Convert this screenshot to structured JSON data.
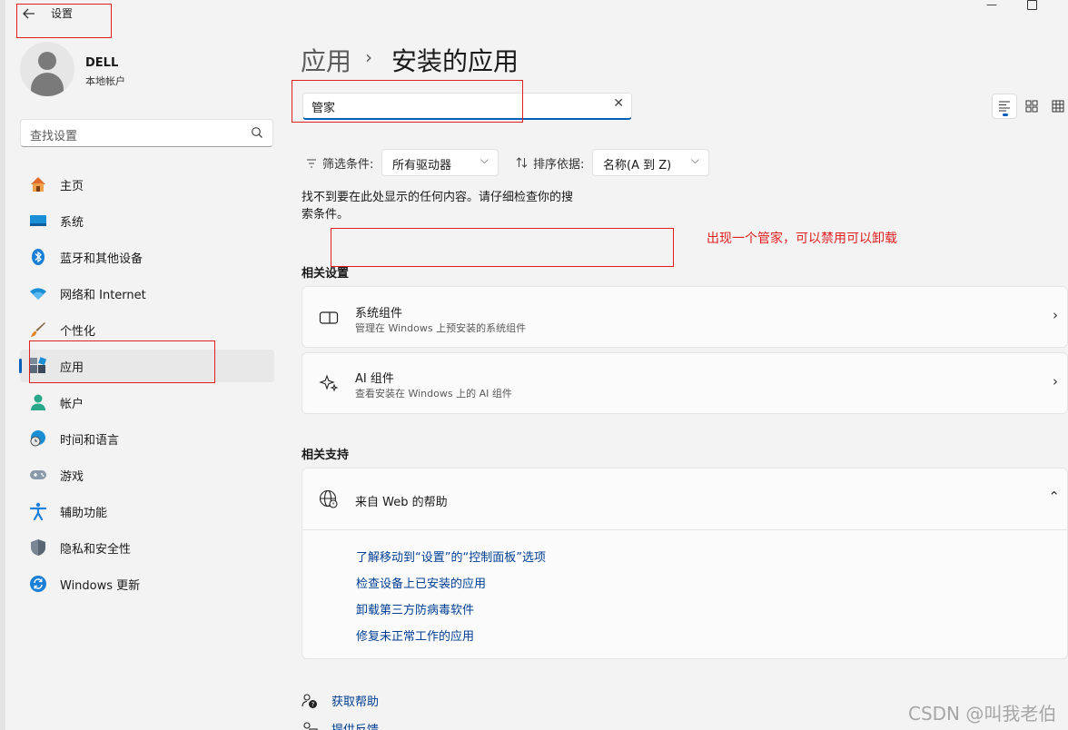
{
  "window": {
    "title": "设置",
    "back_icon": "arrow-left-icon",
    "minimize_glyph": "—"
  },
  "profile": {
    "name": "DELL",
    "account_type": "本地帐户"
  },
  "sidebar": {
    "search_placeholder": "查找设置",
    "items": [
      {
        "label": "主页",
        "icon": "home-icon"
      },
      {
        "label": "系统",
        "icon": "system-icon"
      },
      {
        "label": "蓝牙和其他设备",
        "icon": "bluetooth-icon"
      },
      {
        "label": "网络和 Internet",
        "icon": "wifi-icon"
      },
      {
        "label": "个性化",
        "icon": "brush-icon"
      },
      {
        "label": "应用",
        "icon": "apps-icon",
        "active": true
      },
      {
        "label": "帐户",
        "icon": "account-icon"
      },
      {
        "label": "时间和语言",
        "icon": "globe-clock-icon"
      },
      {
        "label": "游戏",
        "icon": "gamepad-icon"
      },
      {
        "label": "辅助功能",
        "icon": "accessibility-icon"
      },
      {
        "label": "隐私和安全性",
        "icon": "shield-icon"
      },
      {
        "label": "Windows 更新",
        "icon": "update-icon"
      }
    ]
  },
  "header": {
    "breadcrumb_parent": "应用",
    "breadcrumb_separator": "›",
    "breadcrumb_current": "安装的应用"
  },
  "search": {
    "value": "管家",
    "clear_glyph": "✕"
  },
  "filters": {
    "filter_label": "筛选条件:",
    "filter_value": "所有驱动器",
    "sort_label": "排序依据:",
    "sort_value": "名称(A 到 Z)",
    "chevron_glyph": "⌵"
  },
  "results": {
    "empty_message": "找不到要在此处显示的任何内容。请仔细检查你的搜索条件。"
  },
  "annotation": {
    "text": "出现一个管家，可以禁用可以卸载"
  },
  "related_settings": {
    "title": "相关设置",
    "items": [
      {
        "title": "系统组件",
        "subtitle": "管理在 Windows 上预安装的系统组件",
        "icon": "system-components-icon"
      },
      {
        "title": "AI 组件",
        "subtitle": "查看安装在 Windows 上的 AI 组件",
        "icon": "sparkle-icon"
      }
    ],
    "chevron_glyph": "›"
  },
  "related_support": {
    "title": "相关支持",
    "help_title": "来自 Web 的帮助",
    "collapse_glyph": "⌃",
    "links": [
      "了解移动到“设置”的“控制面板”选项",
      "检查设备上已安装的应用",
      "卸载第三方防病毒软件",
      "修复未正常工作的应用"
    ]
  },
  "footer": {
    "get_help": "获取帮助",
    "feedback": "提供反馈"
  },
  "watermark": "CSDN @叫我老伯",
  "colors": {
    "accent": "#005fb8",
    "link": "#003e92",
    "annotation_red": "#e02020",
    "background": "#f3f3f3"
  }
}
